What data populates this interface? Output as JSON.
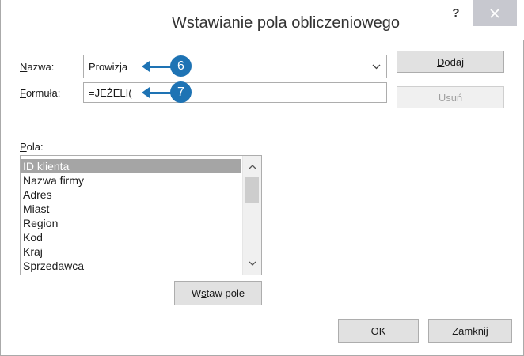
{
  "window": {
    "title": "Wstawianie pola obliczeniowego",
    "help_label": "?"
  },
  "name_field": {
    "label_prefix": "",
    "label_access": "N",
    "label_rest": "azwa:",
    "value": "Prowizja"
  },
  "formula_field": {
    "label_access": "F",
    "label_rest": "ormuła:",
    "value": "=JEŻELI("
  },
  "buttons": {
    "add_access": "D",
    "add_rest": "odaj",
    "delete_label": "Usuń",
    "insert_prefix": "W",
    "insert_access": "s",
    "insert_rest": "taw pole",
    "ok_label": "OK",
    "close_label": "Zamknij"
  },
  "fields_list": {
    "label_access": "P",
    "label_rest": "ola:",
    "items": [
      "ID klienta",
      "Nazwa firmy",
      "Adres",
      "Miast",
      "Region",
      "Kod",
      "Kraj",
      "Sprzedawca"
    ],
    "selected_index": 0
  },
  "callouts": [
    "6",
    "7"
  ],
  "colors": {
    "callout": "#1e73b4",
    "close_button": "#c7c8cf",
    "selection": "#a5a5a5"
  }
}
